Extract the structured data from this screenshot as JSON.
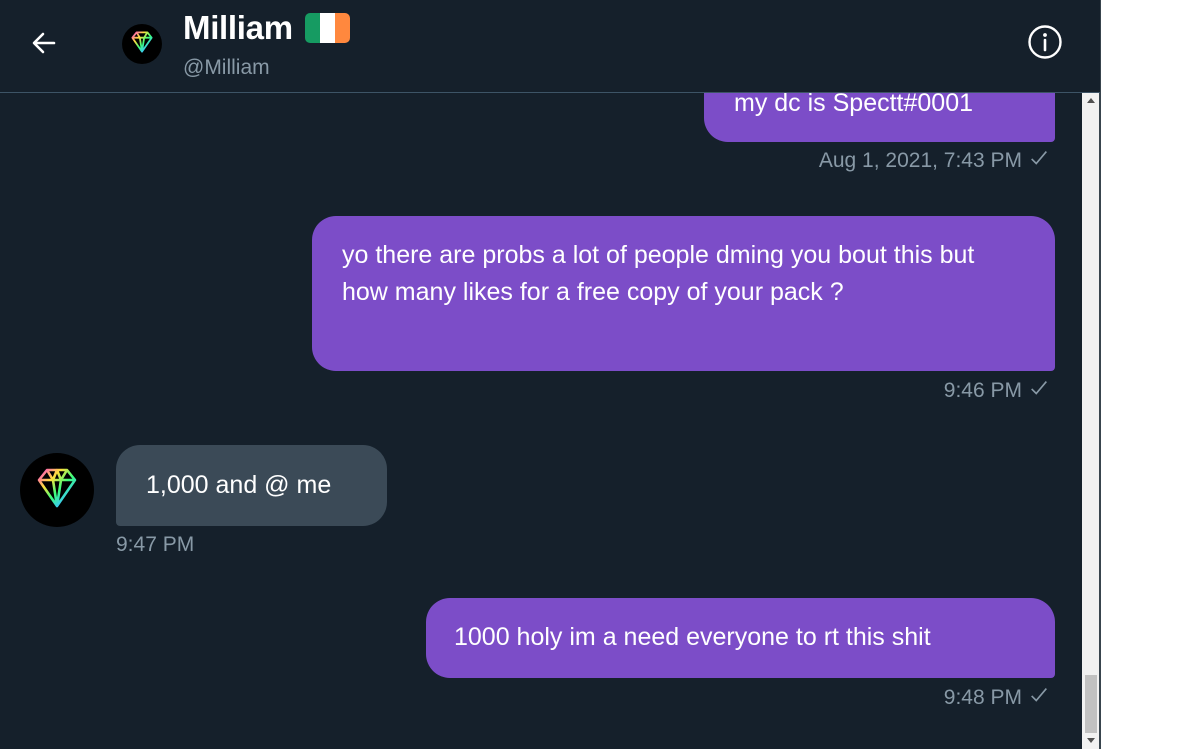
{
  "header": {
    "name": "Milliam",
    "handle": "@Milliam",
    "flag_colors": [
      "#169b62",
      "#ffffff",
      "#ff883e"
    ]
  },
  "icons": {
    "back": "arrow-left-icon",
    "info": "info-icon",
    "avatar": "diamond-icon",
    "read_receipt": "check-icon"
  },
  "colors": {
    "background": "#15202b",
    "sent_bubble": "#7c4dc8",
    "received_bubble": "#3b4a57",
    "meta_text": "#8899a6"
  },
  "messages": [
    {
      "direction": "sent",
      "text": "my dc is Spectt#0001",
      "time": "Aug 1, 2021, 7:43 PM",
      "receipt": "✓"
    },
    {
      "direction": "sent",
      "text": "yo there are probs a lot of people dming you bout this but how many likes for a free copy of your pack ?",
      "time": "9:46 PM",
      "receipt": "✓"
    },
    {
      "direction": "received",
      "text": "1,000 and @ me",
      "time": "9:47 PM"
    },
    {
      "direction": "sent",
      "text": "1000 holy im a need everyone to rt this shit",
      "time": "9:48 PM",
      "receipt": "✓"
    }
  ]
}
